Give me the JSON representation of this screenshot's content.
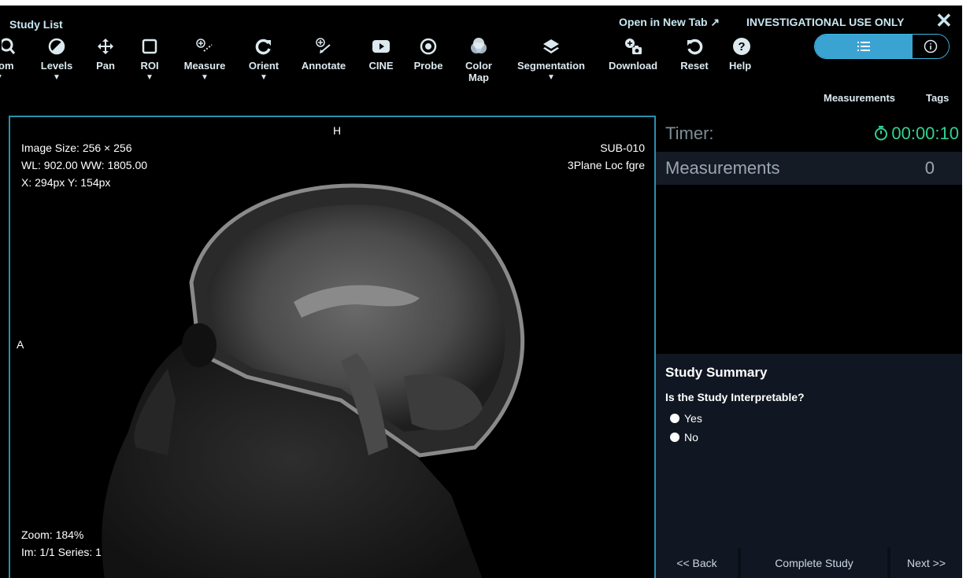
{
  "header": {
    "study_list": "Study List",
    "open_new_tab": "Open in New Tab ↗",
    "investigational": "INVESTIGATIONAL USE ONLY",
    "close": "✕"
  },
  "toolbar": {
    "zoom_partial": "om",
    "levels": "Levels",
    "pan": "Pan",
    "roi": "ROI",
    "measure": "Measure",
    "orient": "Orient",
    "annotate": "Annotate",
    "cine": "CINE",
    "probe": "Probe",
    "colormap_1": "Color",
    "colormap_2": "Map",
    "segmentation": "Segmentation",
    "download": "Download",
    "reset": "Reset",
    "help": "Help"
  },
  "toggle": {
    "measurements": "Measurements",
    "tags": "Tags"
  },
  "viewport": {
    "orientation_top": "H",
    "orientation_left": "A",
    "image_size": "Image Size: 256 × 256",
    "wl_ww": "WL: 902.00 WW: 1805.00",
    "xy": "X: 294px Y: 154px",
    "subject": "SUB-010",
    "series_desc": "3Plane Loc fgre",
    "zoom": "Zoom: 184%",
    "im_series": "Im: 1/1 Series: 1"
  },
  "panel": {
    "timer_label": "Timer:",
    "timer_value": "00:00:10",
    "measurements_label": "Measurements",
    "measurements_count": "0",
    "summary_title": "Study Summary",
    "question": "Is the Study Interpretable?",
    "option_yes": "Yes",
    "option_no": "No",
    "back": "<< Back",
    "complete": "Complete Study",
    "next": "Next >>"
  },
  "colors": {
    "accent": "#3aa3d2",
    "timer": "#33d18f",
    "border": "#2b8fae"
  }
}
